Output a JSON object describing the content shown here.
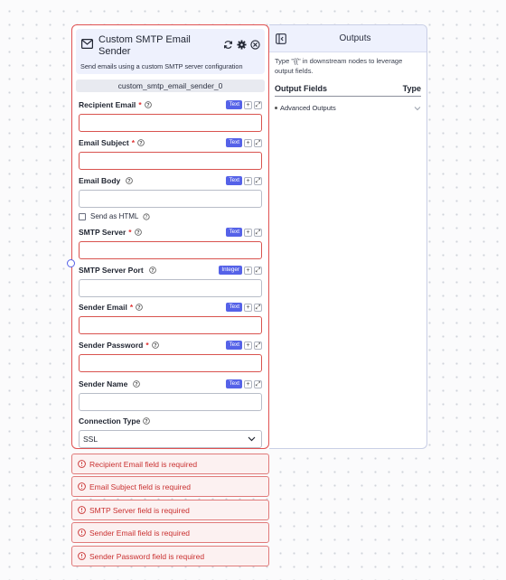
{
  "node": {
    "title": "Custom SMTP Email Sender",
    "description": "Send emails using a custom SMTP server configuration",
    "id": "custom_smtp_email_sender_0"
  },
  "fields": [
    {
      "label": "Recipient Email",
      "required": "*",
      "type": "Text",
      "value": ""
    },
    {
      "label": "Email Subject",
      "required": "*",
      "type": "Text",
      "value": ""
    },
    {
      "label": "Email Body",
      "required": "",
      "type": "Text",
      "value": ""
    },
    {
      "label": "SMTP Server",
      "required": "*",
      "type": "Text",
      "value": ""
    },
    {
      "label": "SMTP Server Port",
      "required": "",
      "type": "Integer",
      "value": ""
    },
    {
      "label": "Sender Email",
      "required": "*",
      "type": "Text",
      "value": ""
    },
    {
      "label": "Sender Password",
      "required": "*",
      "type": "Text",
      "value": ""
    },
    {
      "label": "Sender Name",
      "required": "",
      "type": "Text",
      "value": ""
    }
  ],
  "send_as_html": {
    "label": "Send as HTML",
    "checked": false
  },
  "connection_type": {
    "label": "Connection Type",
    "value": "SSL"
  },
  "outputs": {
    "title": "Outputs",
    "hint": "Type \"{{\" in downstream nodes to leverage output fields.",
    "col_fields": "Output Fields",
    "col_type": "Type",
    "advanced": "Advanced Outputs"
  },
  "errors": [
    "Recipient Email field is required",
    "Email Subject field is required",
    "SMTP Server field is required",
    "Sender Email field is required",
    "Sender Password field is required"
  ],
  "colors": {
    "accent": "#5562e8",
    "error": "#d9534f"
  }
}
